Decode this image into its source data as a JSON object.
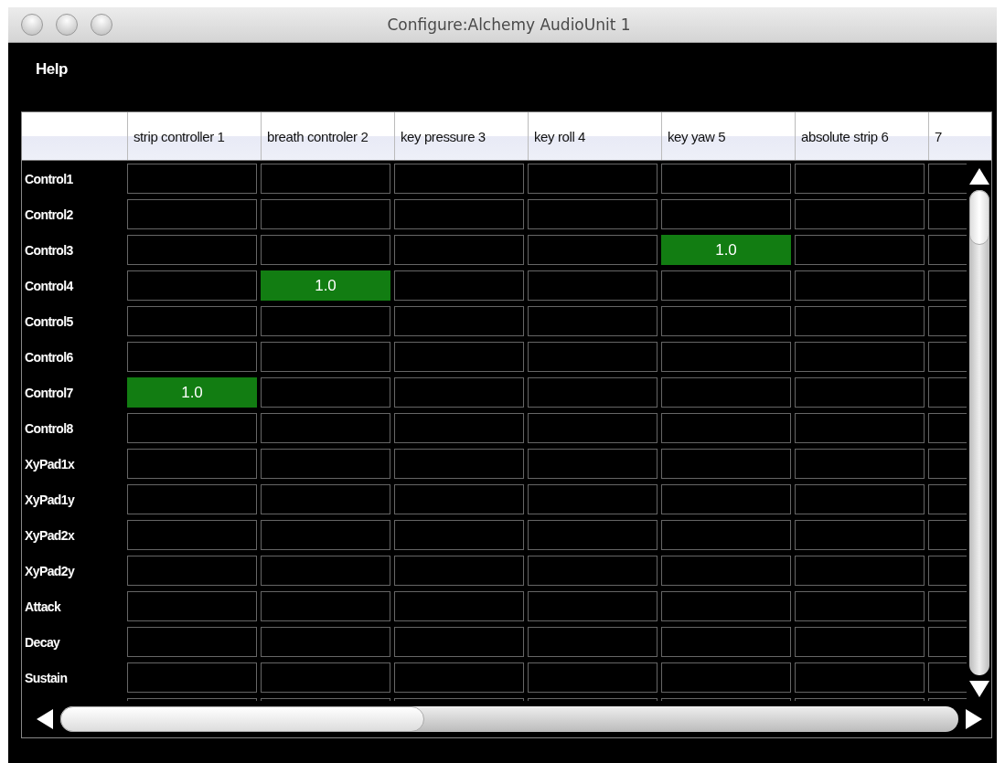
{
  "window": {
    "title": "Configure:Alchemy AudioUnit 1"
  },
  "menu": [
    "Help"
  ],
  "columns": [
    "strip controller 1",
    "breath controler 2",
    "key pressure 3",
    "key roll 4",
    "key yaw 5",
    "absolute strip 6",
    "7"
  ],
  "rows": [
    {
      "label": "Control1",
      "cells": [
        {
          "assigned": false
        },
        {
          "assigned": false
        },
        {
          "assigned": false
        },
        {
          "assigned": false
        },
        {
          "assigned": false
        },
        {
          "assigned": false
        },
        {
          "assigned": false
        }
      ]
    },
    {
      "label": "Control2",
      "cells": [
        {
          "assigned": false
        },
        {
          "assigned": false
        },
        {
          "assigned": false
        },
        {
          "assigned": false
        },
        {
          "assigned": false
        },
        {
          "assigned": false
        },
        {
          "assigned": false
        }
      ]
    },
    {
      "label": "Control3",
      "cells": [
        {
          "assigned": false
        },
        {
          "assigned": false
        },
        {
          "assigned": false
        },
        {
          "assigned": false
        },
        {
          "assigned": true,
          "value": "1.0"
        },
        {
          "assigned": false
        },
        {
          "assigned": false
        }
      ]
    },
    {
      "label": "Control4",
      "cells": [
        {
          "assigned": false
        },
        {
          "assigned": true,
          "value": "1.0"
        },
        {
          "assigned": false
        },
        {
          "assigned": false
        },
        {
          "assigned": false
        },
        {
          "assigned": false
        },
        {
          "assigned": false
        }
      ]
    },
    {
      "label": "Control5",
      "cells": [
        {
          "assigned": false
        },
        {
          "assigned": false
        },
        {
          "assigned": false
        },
        {
          "assigned": false
        },
        {
          "assigned": false
        },
        {
          "assigned": false
        },
        {
          "assigned": false
        }
      ]
    },
    {
      "label": "Control6",
      "cells": [
        {
          "assigned": false
        },
        {
          "assigned": false
        },
        {
          "assigned": false
        },
        {
          "assigned": false
        },
        {
          "assigned": false
        },
        {
          "assigned": false
        },
        {
          "assigned": false
        }
      ]
    },
    {
      "label": "Control7",
      "cells": [
        {
          "assigned": true,
          "value": "1.0"
        },
        {
          "assigned": false
        },
        {
          "assigned": false
        },
        {
          "assigned": false
        },
        {
          "assigned": false
        },
        {
          "assigned": false
        },
        {
          "assigned": false
        }
      ]
    },
    {
      "label": "Control8",
      "cells": [
        {
          "assigned": false
        },
        {
          "assigned": false
        },
        {
          "assigned": false
        },
        {
          "assigned": false
        },
        {
          "assigned": false
        },
        {
          "assigned": false
        },
        {
          "assigned": false
        }
      ]
    },
    {
      "label": "XyPad1x",
      "cells": [
        {
          "assigned": false
        },
        {
          "assigned": false
        },
        {
          "assigned": false
        },
        {
          "assigned": false
        },
        {
          "assigned": false
        },
        {
          "assigned": false
        },
        {
          "assigned": false
        }
      ]
    },
    {
      "label": "XyPad1y",
      "cells": [
        {
          "assigned": false
        },
        {
          "assigned": false
        },
        {
          "assigned": false
        },
        {
          "assigned": false
        },
        {
          "assigned": false
        },
        {
          "assigned": false
        },
        {
          "assigned": false
        }
      ]
    },
    {
      "label": "XyPad2x",
      "cells": [
        {
          "assigned": false
        },
        {
          "assigned": false
        },
        {
          "assigned": false
        },
        {
          "assigned": false
        },
        {
          "assigned": false
        },
        {
          "assigned": false
        },
        {
          "assigned": false
        }
      ]
    },
    {
      "label": "XyPad2y",
      "cells": [
        {
          "assigned": false
        },
        {
          "assigned": false
        },
        {
          "assigned": false
        },
        {
          "assigned": false
        },
        {
          "assigned": false
        },
        {
          "assigned": false
        },
        {
          "assigned": false
        }
      ]
    },
    {
      "label": "Attack",
      "cells": [
        {
          "assigned": false
        },
        {
          "assigned": false
        },
        {
          "assigned": false
        },
        {
          "assigned": false
        },
        {
          "assigned": false
        },
        {
          "assigned": false
        },
        {
          "assigned": false
        }
      ]
    },
    {
      "label": "Decay",
      "cells": [
        {
          "assigned": false
        },
        {
          "assigned": false
        },
        {
          "assigned": false
        },
        {
          "assigned": false
        },
        {
          "assigned": false
        },
        {
          "assigned": false
        },
        {
          "assigned": false
        }
      ]
    },
    {
      "label": "Sustain",
      "cells": [
        {
          "assigned": false
        },
        {
          "assigned": false
        },
        {
          "assigned": false
        },
        {
          "assigned": false
        },
        {
          "assigned": false
        },
        {
          "assigned": false
        },
        {
          "assigned": false
        }
      ]
    },
    {
      "cells": [
        {
          "assigned": false
        },
        {
          "assigned": false
        },
        {
          "assigned": false
        },
        {
          "assigned": false
        },
        {
          "assigned": false
        },
        {
          "assigned": false
        },
        {
          "assigned": false
        }
      ]
    }
  ]
}
